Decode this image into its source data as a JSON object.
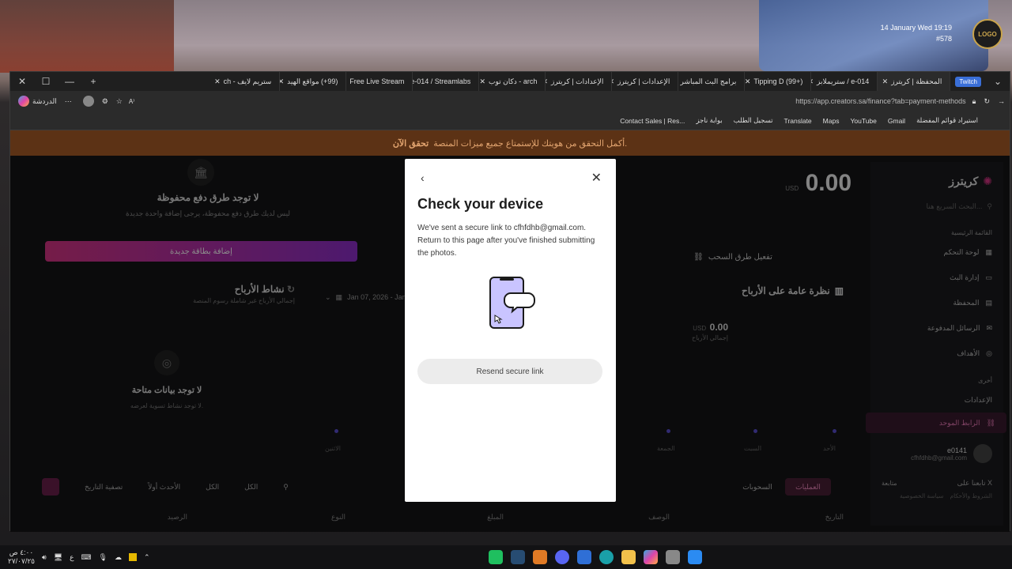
{
  "hud": {
    "datetime": "14 January Wed 19:19",
    "player_id": "#578"
  },
  "browser": {
    "tabs": [
      {
        "label": "المحفظة | كريترز",
        "active": true
      },
      {
        "label": "e-014 / ستريملابز"
      },
      {
        "label": "Tipping D (99+)"
      },
      {
        "label": "برامج البث المباشر"
      },
      {
        "label": "الإعدادات | كريترز"
      },
      {
        "label": "الإعدادات | كريترز"
      },
      {
        "label": "arch - دكان توب"
      },
      {
        "label": "e-014 / Streamlabs"
      },
      {
        "label": "Free Live Stream"
      },
      {
        "label": "(99+) مواقع الهيد"
      },
      {
        "label": "ستريم لايف - ch"
      }
    ],
    "twitch_badge": "Twitch",
    "url": "https://app.creators.sa/finance?tab=payment-methods",
    "url_host": "app.creators.sa",
    "copilot_label": "الدردشة",
    "bookmarks": [
      "Contact Sales | Res...",
      "بوابة ناجز",
      "تسجيل الطلب",
      "Translate",
      "Maps",
      "YouTube",
      "Gmail",
      "استيراد قوائم المفضلة"
    ]
  },
  "banner": {
    "text": "أكمل التحقق من هويتك للإستمتاع جميع ميزات المنصة.",
    "link": "تحقق الآن"
  },
  "sidebar": {
    "brand": "كريترز",
    "search_placeholder": "البحث السريع هنا...",
    "section_main": "القائمة الرئيسية",
    "items": [
      "لوحة التحكم",
      "إدارة البث",
      "المحفظة",
      "الرسائل المدفوعة",
      "الأهداف"
    ],
    "section_other": "أخرى",
    "settings": "الإعدادات",
    "unified_link": "الرابط الموحد",
    "user_name": "e0141",
    "user_email": "cfhfdhb@gmail.com",
    "follow_x": "تابعنا على X",
    "follow_btn": "متابعة",
    "terms": "الشروط والأحكام",
    "privacy": "سياسة الخصوصية"
  },
  "wallet": {
    "balance": "0.00",
    "currency": "USD",
    "enable_withdraw": "تفعيل طرق السحب",
    "no_methods_title": "لا توجد طرق دفع محفوظة",
    "no_methods_sub": "ليس لديك طرق دفع محفوظة، يرجى إضافة واحدة جديدة",
    "add_card": "إضافة بطاقة جديدة",
    "overview_title": "نظرة عامة على الأرباح",
    "overview_value": "0.00",
    "overview_label": "إجمالي الأرباح",
    "activity_title": "نشاط الأرباح",
    "activity_sub": "إجمالي الأرباح غير شاملة رسوم المنصة",
    "date_range": "Jan 07, 2026 - Jan",
    "no_data_title": "لا توجد بيانات متاحة",
    "no_data_sub": "لا توجد نشاط تسوية لعرضه.",
    "days": [
      "الأحد",
      "السبت",
      "الجمعة",
      "الاثنين"
    ],
    "tabs": [
      "العمليات",
      "السحوبات"
    ],
    "filters": [
      "الكل",
      "الكل",
      "الأحدث أولاً",
      "تصفية التاريخ"
    ],
    "columns": [
      "التاريخ",
      "الوصف",
      "المبلغ",
      "النوع",
      "الرصيد"
    ]
  },
  "modal": {
    "title": "Check your device",
    "message": "We've sent a secure link to cfhfdhb@gmail.com. Return to this page after you've finished submitting the photos.",
    "resend": "Resend secure link"
  },
  "taskbar": {
    "time": "٤:٠٠ ص",
    "date": "٢٧/٠٧/٢٥",
    "lang": "ع"
  },
  "colors": {
    "accent": "#d63384",
    "banner_bg": "#5c3215",
    "modal_bg": "#ffffff",
    "phone": "#c9c4ff"
  }
}
